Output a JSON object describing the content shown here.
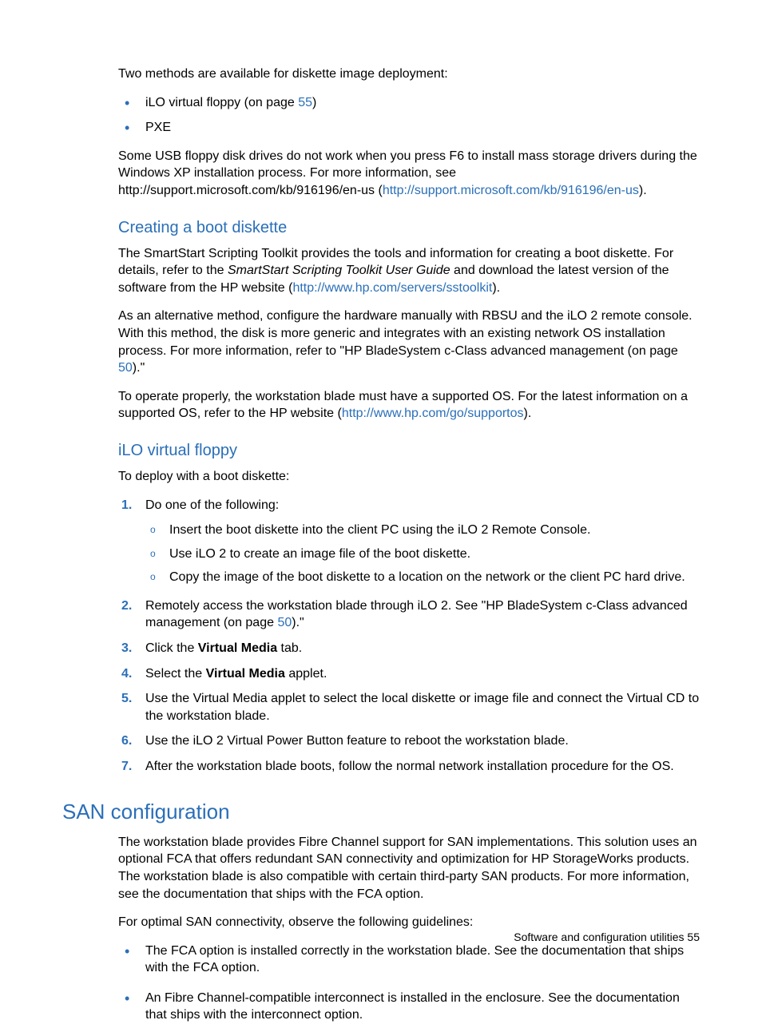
{
  "intro_para": "Two methods are available for diskette image deployment:",
  "intro_bullets": {
    "b0_pre": "iLO virtual floppy (on page ",
    "b0_link": "55",
    "b0_post": ")",
    "b1": "PXE"
  },
  "usb_para_pre": "Some USB floppy disk drives do not work when you press F6 to install mass storage drivers during the Windows XP installation process. For more information, see http://support.microsoft.com/kb/916196/en-us (",
  "usb_para_link": "http://support.microsoft.com/kb/916196/en-us",
  "usb_para_post": ").",
  "h_create": "Creating a boot diskette",
  "create_p1_a": "The SmartStart Scripting Toolkit provides the tools and information for creating a boot diskette. For details, refer to the ",
  "create_p1_italic": "SmartStart Scripting Toolkit User Guide",
  "create_p1_b": " and download the latest version of the software from the HP website (",
  "create_p1_link": "http://www.hp.com/servers/sstoolkit",
  "create_p1_c": ").",
  "create_p2_a": "As an alternative method, configure the hardware manually with RBSU and the iLO 2 remote console. With this method, the disk is more generic and integrates with an existing network OS installation process. For more information, refer to \"HP BladeSystem c-Class advanced management (on page ",
  "create_p2_link": "50",
  "create_p2_b": ").\"",
  "create_p3_a": "To operate properly, the workstation blade must have a supported OS. For the latest information on a supported OS, refer to the HP website (",
  "create_p3_link": "http://www.hp.com/go/supportos",
  "create_p3_b": ").",
  "h_ilo": "iLO virtual floppy",
  "ilo_intro": "To deploy with a boot diskette:",
  "ilo_steps": {
    "s1": "Do one of the following:",
    "s1_sub": [
      "Insert the boot diskette into the client PC using the iLO 2 Remote Console.",
      "Use iLO 2 to create an image file of the boot diskette.",
      "Copy the image of the boot diskette to a location on the network or the client PC hard drive."
    ],
    "s2_a": "Remotely access the workstation blade through iLO 2. See \"HP BladeSystem c-Class advanced management (on page ",
    "s2_link": "50",
    "s2_b": ").\"",
    "s3_a": "Click the ",
    "s3_bold": "Virtual Media",
    "s3_b": " tab.",
    "s4_a": "Select the ",
    "s4_bold": "Virtual Media",
    "s4_b": " applet.",
    "s5": "Use the Virtual Media applet to select the local diskette or image file and connect the Virtual CD to the workstation blade.",
    "s6": "Use the iLO 2 Virtual Power Button feature to reboot the workstation blade.",
    "s7": "After the workstation blade boots, follow the normal network installation procedure for the OS."
  },
  "h_san": "SAN configuration",
  "san_p1": "The workstation blade provides Fibre Channel support for SAN implementations. This solution uses an optional FCA that offers redundant SAN connectivity and optimization for HP StorageWorks products. The workstation blade is also compatible with certain third-party SAN products. For more information, see the documentation that ships with the FCA option.",
  "san_p2": "For optimal SAN connectivity, observe the following guidelines:",
  "san_bullets": [
    "The FCA option is installed correctly in the workstation blade. See the documentation that ships with the FCA option.",
    "An Fibre Channel-compatible interconnect is installed in the enclosure. See the documentation that ships with the interconnect option."
  ],
  "footer_text": "Software and configuration utilities   55"
}
